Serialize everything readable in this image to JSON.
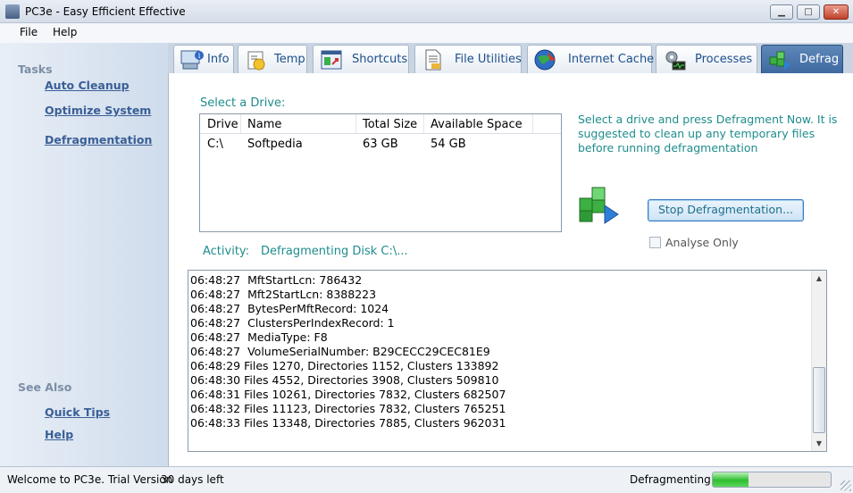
{
  "window": {
    "title": "PC3e - Easy Efficient Effective",
    "buttons": {
      "minimize": "▁",
      "maximize": "□",
      "close": "✕"
    }
  },
  "menu": {
    "file": "File",
    "help": "Help"
  },
  "sidebar": {
    "tasks_heading": "Tasks",
    "tasks": [
      "Auto Cleanup",
      "Optimize System",
      "Defragmentation"
    ],
    "see_also_heading": "See Also",
    "see_also": [
      "Quick Tips",
      "Help"
    ]
  },
  "tabs": [
    {
      "label": "Info",
      "icon": "info-icon"
    },
    {
      "label": "Temp",
      "icon": "temp-icon"
    },
    {
      "label": "Shortcuts",
      "icon": "shortcuts-icon"
    },
    {
      "label": "File Utilities",
      "icon": "file-utilities-icon"
    },
    {
      "label": "Internet Cache",
      "icon": "internet-cache-icon"
    },
    {
      "label": "Processes",
      "icon": "processes-icon"
    },
    {
      "label": "Defrag",
      "icon": "defrag-icon",
      "active": true
    }
  ],
  "drive_section": {
    "label": "Select a Drive:",
    "columns": [
      "Drive",
      "Name",
      "Total Size",
      "Available Space"
    ],
    "rows": [
      {
        "drive": "C:\\",
        "name": "Softpedia",
        "total": "63 GB",
        "available": "54 GB"
      }
    ]
  },
  "hint": "Select a drive and press Defragment Now. It is suggested to clean up any temporary files before running defragmentation",
  "stop_button": "Stop Defragmentation...",
  "analyse_only": {
    "label": "Analyse Only",
    "checked": false
  },
  "activity": {
    "label": "Activity:",
    "value": "Defragmenting Disk C:\\..."
  },
  "log": [
    "06:48:27  MftStartLcn: 786432",
    "06:48:27  Mft2StartLcn: 8388223",
    "06:48:27  BytesPerMftRecord: 1024",
    "06:48:27  ClustersPerIndexRecord: 1",
    "06:48:27  MediaType: F8",
    "06:48:27  VolumeSerialNumber: B29CECC29CEC81E9",
    "06:48:29 Files 1270, Directories 1152, Clusters 133892",
    "06:48:30 Files 4552, Directories 3908, Clusters 509810",
    "06:48:31 Files 10261, Directories 7832, Clusters 682507",
    "06:48:32 Files 11123, Directories 7832, Clusters 765251",
    "06:48:33 Files 13348, Directories 7885, Clusters 962031"
  ],
  "status": {
    "left": "Welcome to PC3e. Trial Version",
    "days": "30 days left",
    "right": "Defragmenting...",
    "progress": 0.3
  },
  "colors": {
    "accent": "#1f8c8c",
    "link": "#3a5f96",
    "active_tab": "#4a75ad",
    "progress": "#2fbf2f"
  }
}
